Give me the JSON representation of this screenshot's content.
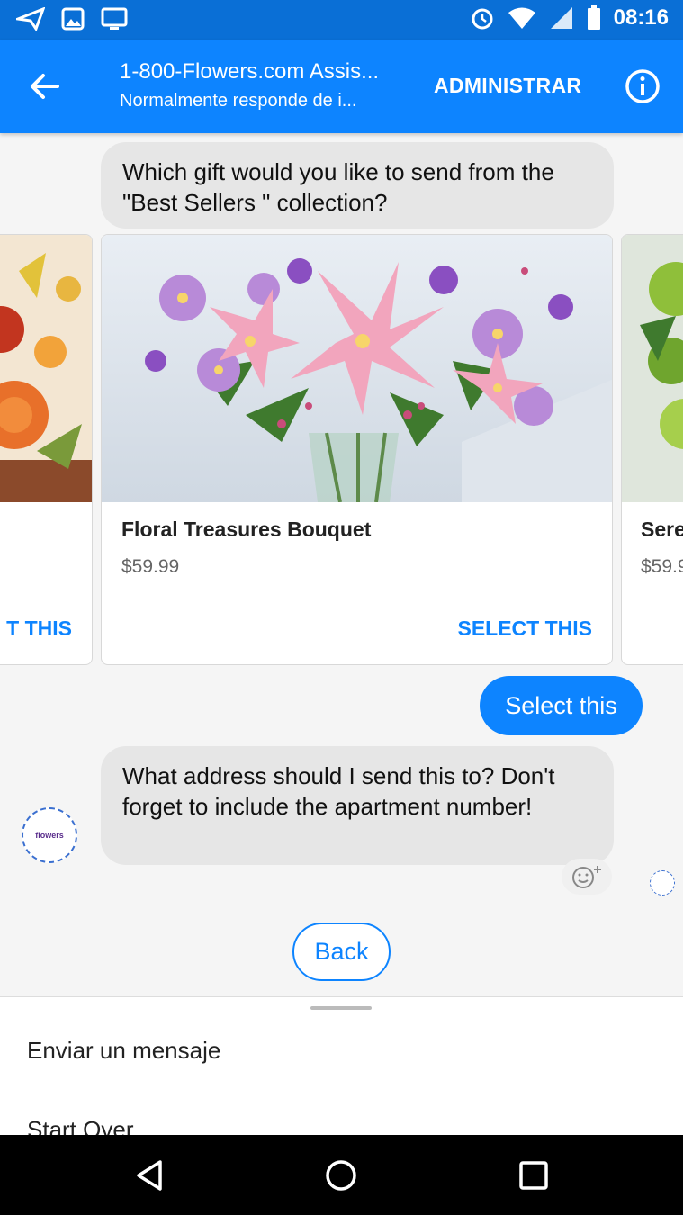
{
  "status_bar": {
    "time": "08:16",
    "icons": [
      "send-icon",
      "image-icon",
      "cast-icon",
      "alarm-icon",
      "wifi-icon",
      "signal-icon",
      "battery-icon"
    ]
  },
  "header": {
    "title": "1-800-Flowers.com Assis...",
    "subtitle": "Normalmente responde de i...",
    "manage_label": "ADMINISTRAR",
    "back_icon": "back-arrow-icon",
    "info_icon": "info-icon",
    "color": "#0d84ff"
  },
  "messages": {
    "q1": "Which gift would you like to send from the \"Best Sellers \" collection?",
    "user_reply": "Select this",
    "q2": "What address should I send this to? Don't forget to include the apartment number!"
  },
  "cards": {
    "left": {
      "action": "T THIS"
    },
    "main": {
      "title": "Floral Treasures Bouquet",
      "price": "$59.99",
      "action": "SELECT THIS"
    },
    "right": {
      "title": "Sere",
      "price": "$59.9"
    }
  },
  "avatar": {
    "logo_text": "flowers"
  },
  "quick_reply": {
    "back_label": "Back"
  },
  "bottom_sheet": {
    "items": [
      "Enviar un mensaje",
      "Start Over"
    ]
  },
  "nav_bar": {
    "icons": [
      "nav-back-icon",
      "nav-home-icon",
      "nav-recents-icon"
    ]
  }
}
